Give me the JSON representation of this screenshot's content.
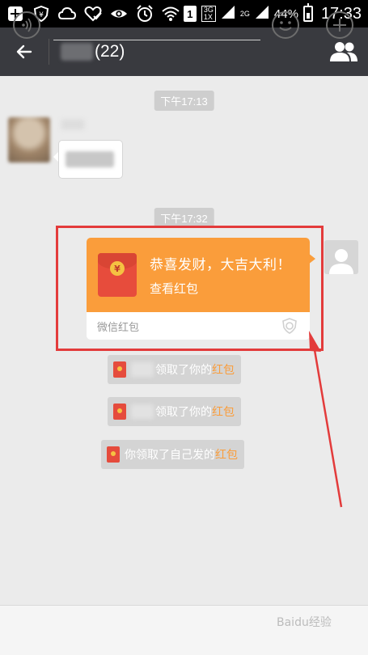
{
  "status_bar": {
    "battery_percent": "44%",
    "time": "17:33",
    "sim_number": "1",
    "network_3g": "3G",
    "network_1x": "1X",
    "network_2g": "2G",
    "icons": [
      "add-box-icon",
      "shield-icon",
      "cloud-icon",
      "checked-heart-icon",
      "eye-icon",
      "alarm-icon",
      "wifi-icon",
      "signal-icon",
      "battery-icon"
    ]
  },
  "title_bar": {
    "member_count": "(22)",
    "icons": [
      "back-arrow-icon",
      "group-members-icon"
    ]
  },
  "messages": {
    "time_1": "下午17:13",
    "time_2": "下午17:32"
  },
  "red_packet": {
    "greeting": "恭喜发财，大吉大利！",
    "action": "查看红包",
    "footer": "微信红包",
    "coin_symbol": "¥",
    "bg_color": "#fa9d3b"
  },
  "notices": [
    {
      "text": "领取了你的",
      "highlight": "红包"
    },
    {
      "text": "领取了你的",
      "highlight": "红包"
    },
    {
      "text": "你领取了自己发的",
      "highlight": "红包"
    }
  ],
  "annotation": {
    "highlight_color": "#e33b3b"
  },
  "input_bar": {
    "icons": [
      "voice-icon",
      "emoji-icon",
      "plus-icon"
    ]
  },
  "watermark": "Baidu经验"
}
